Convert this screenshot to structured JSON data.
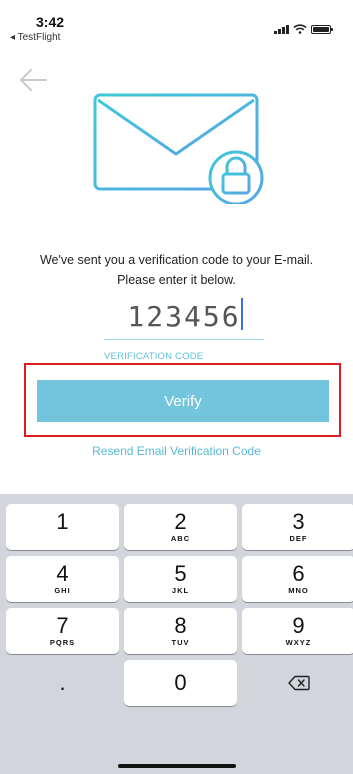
{
  "status_bar": {
    "time": "3:42",
    "back_app": "◂ TestFlight"
  },
  "page": {
    "message_line1": "We've sent you a verification code to your E-mail.",
    "message_line2": "Please enter it below.",
    "code_value": "123456",
    "code_label": "VERIFICATION CODE",
    "verify_label": "Verify",
    "resend_label": "Resend Email Verification Code"
  },
  "keyboard": {
    "keys": [
      {
        "digit": "1",
        "letters": ""
      },
      {
        "digit": "2",
        "letters": "ABC"
      },
      {
        "digit": "3",
        "letters": "DEF"
      },
      {
        "digit": "4",
        "letters": "GHI"
      },
      {
        "digit": "5",
        "letters": "JKL"
      },
      {
        "digit": "6",
        "letters": "MNO"
      },
      {
        "digit": "7",
        "letters": "PQRS"
      },
      {
        "digit": "8",
        "letters": "TUV"
      },
      {
        "digit": "9",
        "letters": "WXYZ"
      },
      {
        "digit": ".",
        "letters": ""
      },
      {
        "digit": "0",
        "letters": ""
      }
    ]
  },
  "colors": {
    "accent": "#72c5dc",
    "link": "#58b9d6",
    "highlight": "#e01b1b",
    "keyboard_bg": "#d2d5db"
  },
  "icons": {
    "back": "left-arrow-icon",
    "hero": "envelope-lock-icon",
    "delete": "backspace-icon"
  }
}
